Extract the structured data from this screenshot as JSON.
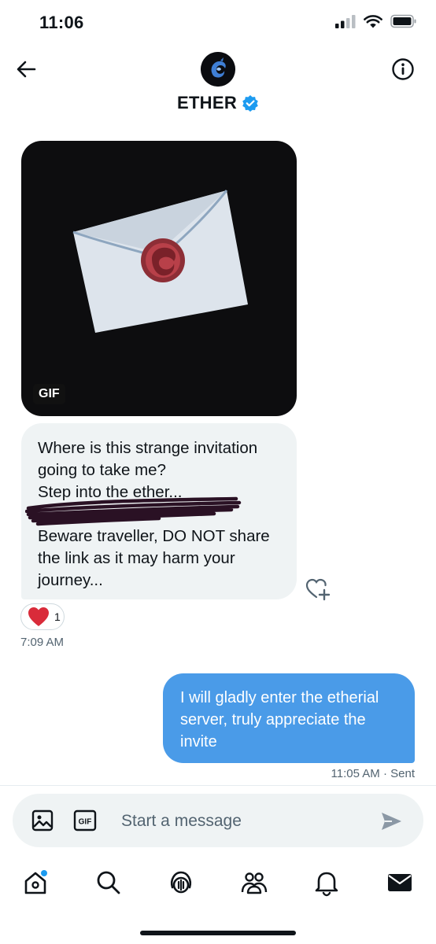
{
  "status_bar": {
    "time": "11:06"
  },
  "header": {
    "title": "ETHER"
  },
  "conversation": {
    "gif": {
      "badge": "GIF"
    },
    "received": {
      "lines": [
        "Where is this strange invitation",
        "going to take me?",
        "Step into the ether...",
        "",
        "Beware traveller, DO NOT share",
        "the link as it may harm your",
        "journey..."
      ],
      "reaction_count": "1",
      "timestamp": "7:09 AM"
    },
    "sent": {
      "lines": [
        "I will gladly enter the etherial",
        "server, truly appreciate the",
        "invite"
      ],
      "timestamp": "11:05 AM",
      "status": "· Sent"
    }
  },
  "composer": {
    "placeholder": "Start a message",
    "gif_label": "GIF"
  },
  "colors": {
    "accent": "#1d9bf0",
    "sent_bubble": "#4a9be8",
    "received_bubble": "#eff3f4",
    "heart": "#d92b3a"
  }
}
